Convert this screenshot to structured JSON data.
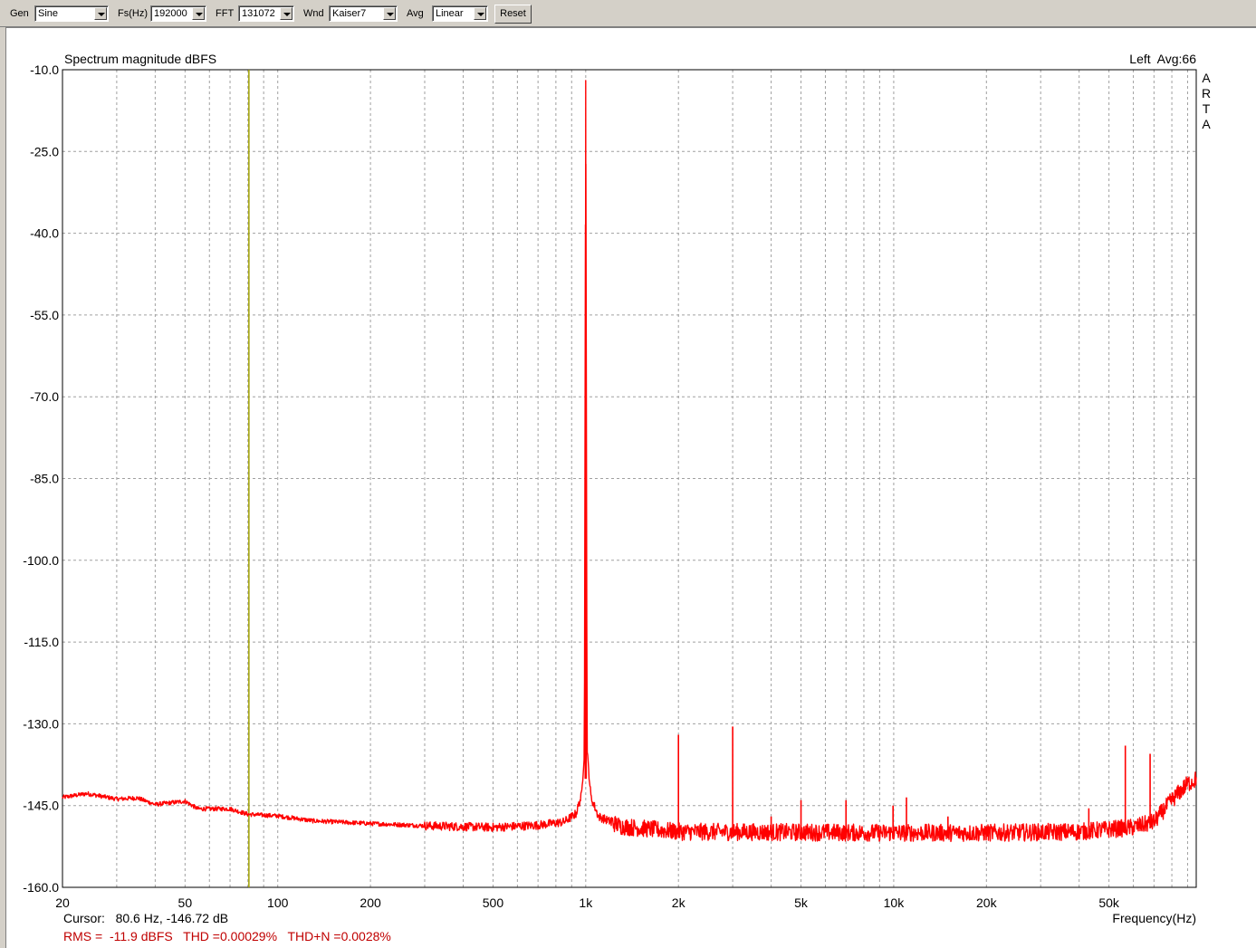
{
  "toolbar": {
    "gen_label": "Gen",
    "gen_value": "Sine",
    "fs_label": "Fs(Hz)",
    "fs_value": "192000",
    "fft_label": "FFT",
    "fft_value": "131072",
    "wnd_label": "Wnd",
    "wnd_value": "Kaiser7",
    "avg_label": "Avg",
    "avg_value": "Linear",
    "reset_label": "Reset"
  },
  "plot": {
    "channel_label": "Left  Avg:66",
    "watermark": [
      "A",
      "R",
      "T",
      "A"
    ],
    "cursor_text": "Cursor:   80.6 Hz, -146.72 dB",
    "stats_text": "RMS =  -11.9 dBFS   THD =0.00029%   THD+N =0.0028%"
  },
  "colors": {
    "trace": "#ff0000",
    "cursor_line": "#a0a000",
    "stats_text": "#c00000",
    "grid": "#a0a0a0"
  },
  "chart_data": {
    "type": "line",
    "title": "Spectrum magnitude dBFS",
    "xlabel": "Frequency(Hz)",
    "ylabel": "",
    "xscale": "log",
    "xlim": [
      20,
      96000
    ],
    "ylim": [
      -160,
      -10
    ],
    "yticks": [
      -10,
      -25,
      -40,
      -55,
      -70,
      -85,
      -100,
      -115,
      -130,
      -145,
      -160
    ],
    "ytick_labels": [
      "-10.0",
      "-25.0",
      "-40.0",
      "-55.0",
      "-70.0",
      "-85.0",
      "-100.0",
      "-115.0",
      "-130.0",
      "-145.0",
      "-160.0"
    ],
    "xticks": [
      20,
      50,
      100,
      200,
      500,
      1000,
      2000,
      5000,
      10000,
      20000,
      50000
    ],
    "xtick_labels": [
      "20",
      "50",
      "100",
      "200",
      "500",
      "1k",
      "2k",
      "5k",
      "10k",
      "20k",
      "50k"
    ],
    "grid": true,
    "cursor": {
      "freq": 80.6,
      "db": -146.72
    },
    "series": [
      {
        "color": "#ff0000",
        "noise_floor": [
          [
            20,
            -143.5
          ],
          [
            24,
            -142.8
          ],
          [
            30,
            -143.8
          ],
          [
            35,
            -143.6
          ],
          [
            40,
            -144.8
          ],
          [
            50,
            -144.2
          ],
          [
            55,
            -145.6
          ],
          [
            70,
            -145.6
          ],
          [
            80,
            -146.6
          ],
          [
            100,
            -146.9
          ],
          [
            130,
            -147.8
          ],
          [
            200,
            -148.3
          ],
          [
            300,
            -148.7
          ],
          [
            500,
            -149.0
          ],
          [
            700,
            -148.6
          ],
          [
            850,
            -148.0
          ],
          [
            930,
            -146.5
          ],
          [
            970,
            -143.0
          ],
          [
            990,
            -135.0
          ],
          [
            1000,
            -12.0
          ],
          [
            1010,
            -135.0
          ],
          [
            1040,
            -143.5
          ],
          [
            1100,
            -147.0
          ],
          [
            1300,
            -148.8
          ],
          [
            2000,
            -149.8
          ],
          [
            5000,
            -149.9
          ],
          [
            10000,
            -150.0
          ],
          [
            20000,
            -150.0
          ],
          [
            40000,
            -149.8
          ],
          [
            60000,
            -149.0
          ],
          [
            70000,
            -148.0
          ],
          [
            80000,
            -144.0
          ],
          [
            90000,
            -141.0
          ],
          [
            96000,
            -140.2
          ]
        ],
        "spikes": [
          [
            2000,
            -132.0
          ],
          [
            3000,
            -130.5
          ],
          [
            4000,
            -147.0
          ],
          [
            5000,
            -144.0
          ],
          [
            7000,
            -144.0
          ],
          [
            9950,
            -145.0
          ],
          [
            11000,
            -143.5
          ],
          [
            15000,
            -147.0
          ],
          [
            43000,
            -145.5
          ],
          [
            56500,
            -134.0
          ],
          [
            68000,
            -135.5
          ]
        ]
      }
    ]
  }
}
